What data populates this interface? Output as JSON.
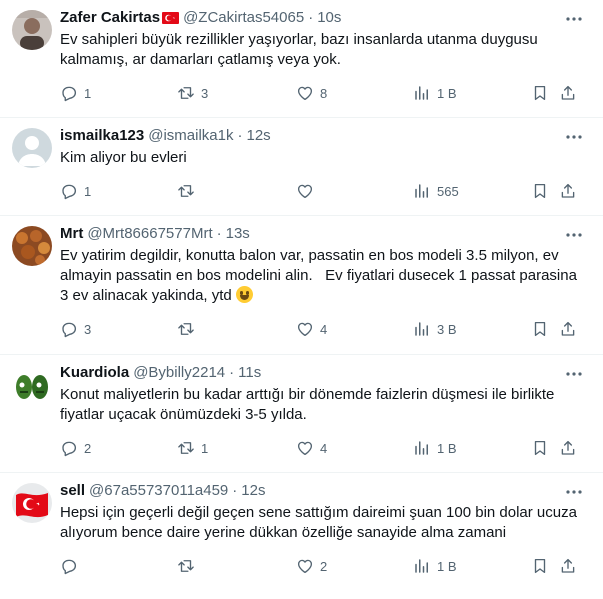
{
  "tweets": [
    {
      "name": "Zafer Cakirtas",
      "handle": "@ZCakirtas54065",
      "time": "10s",
      "text": "Ev sahipleri büyük rezillikler yaşıyorlar, bazı insanlarda utanma duygusu kalmamış, ar damarları çatlamış veya yok.",
      "replies": "1",
      "retweets": "3",
      "likes": "8",
      "views": "1 B"
    },
    {
      "name": "ismailka123",
      "handle": "@ismailka1k",
      "time": "12s",
      "text": "Kim aliyor bu evleri",
      "replies": "1",
      "retweets": "",
      "likes": "",
      "views": "565"
    },
    {
      "name": "Mrt",
      "handle": "@Mrt86667577Mrt",
      "time": "13s",
      "text": "Ev yatirim degildir, konutta balon var, passatin en bos modeli 3.5 milyon, ev almayin passatin en bos modelini alin.   Ev fiyatlari dusecek 1 passat parasina 3 ev alinacak yakinda, ytd",
      "replies": "3",
      "retweets": "",
      "likes": "4",
      "views": "3 B"
    },
    {
      "name": "Kuardiola",
      "handle": "@Bybilly2214",
      "time": "11s",
      "text": "Konut maliyetlerin bu kadar arttığı bir dönemde faizlerin düşmesi ile birlikte fiyatlar uçacak önümüzdeki 3-5 yılda.",
      "replies": "2",
      "retweets": "1",
      "likes": "4",
      "views": "1 B"
    },
    {
      "name": "sell",
      "handle": "@67a55737011a459",
      "time": "12s",
      "text": "Hepsi için geçerli değil geçen sene sattığım daireimi şuan 100 bin dolar ucuza alıyorum bence daire yerine dükkan özelliğe sanayide alma zamani",
      "replies": "",
      "retweets": "",
      "likes": "2",
      "views": "1 B"
    }
  ],
  "separator": "·",
  "colors": {
    "text": "#0f1419",
    "muted": "#536471",
    "border": "#eff3f4"
  }
}
